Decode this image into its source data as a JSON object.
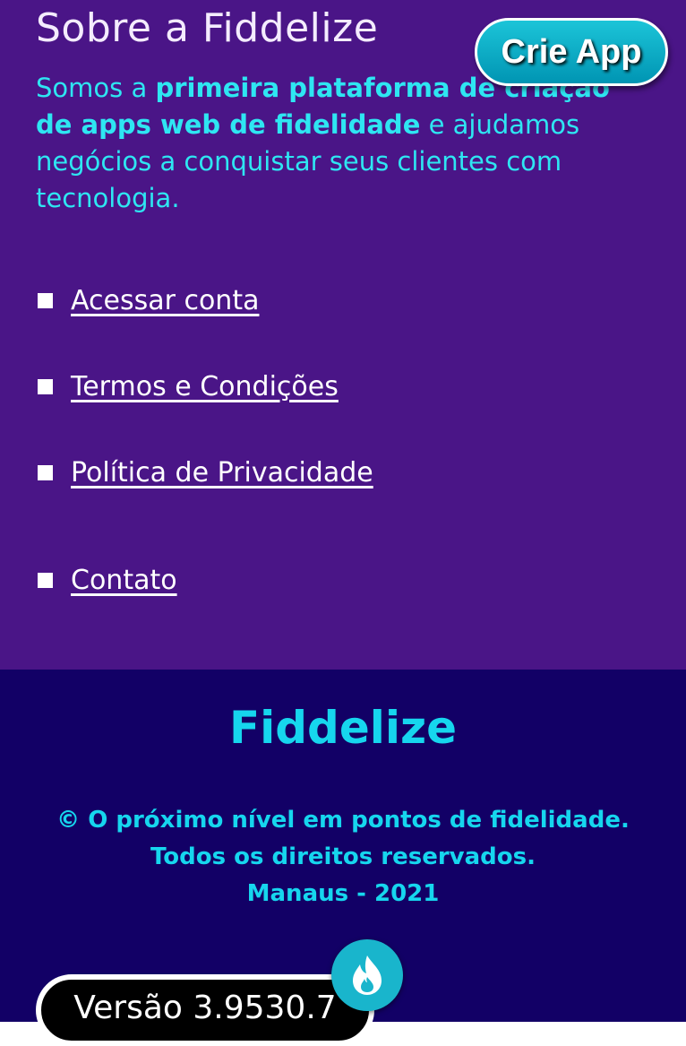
{
  "about": {
    "title": "Sobre a Fiddelize",
    "desc_prefix": "Somos a ",
    "desc_bold": "primeira plataforma de criação de apps web de fidelidade",
    "desc_suffix": " e ajudamos negócios a conquistar seus clientes com tecnologia.",
    "cta_label": "Crie App"
  },
  "links": [
    {
      "label": "Acessar conta"
    },
    {
      "label": "Termos e Condições"
    },
    {
      "label": "Política de Privacidade"
    },
    {
      "label": "Contato"
    }
  ],
  "footer": {
    "brand": "Fiddelize",
    "lines": [
      "© O próximo nível em pontos de fidelidade.",
      "Todos os direitos reservados.",
      "Manaus - 2021"
    ],
    "version": "Versão 3.9530.7"
  },
  "colors": {
    "about_bg": "#4a1587",
    "footer_bg": "#120066",
    "accent": "#16d6ee",
    "cta_bg": "#0fb0c9"
  },
  "icons": {
    "fab": "flame-icon",
    "bullet": "square-bullet-icon"
  }
}
